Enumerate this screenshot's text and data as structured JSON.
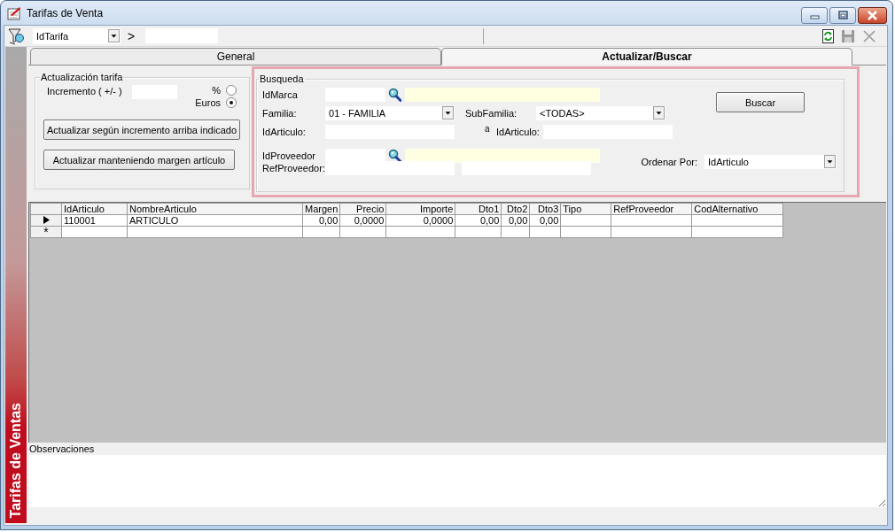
{
  "window": {
    "title": "Tarifas de Venta"
  },
  "toolbar": {
    "selector": {
      "value": "IdTarifa"
    },
    "separator": ">",
    "actions": [
      {
        "kind": "refresh",
        "disabled": false
      },
      {
        "kind": "save",
        "disabled": true
      },
      {
        "kind": "close",
        "disabled": true
      }
    ]
  },
  "side_banner": {
    "text": "Tarifas de Ventas"
  },
  "tabs": [
    {
      "label": "General",
      "selected": false
    },
    {
      "label": "Actualizar/Buscar",
      "selected": true
    }
  ],
  "update_group": {
    "title": "Actualización tarifa",
    "increment_label": "Incremento ( +/- )",
    "options": [
      {
        "label": "%",
        "selected": false
      },
      {
        "label": "Euros",
        "selected": true
      }
    ],
    "buttons": [
      "Actualizar según incremento arriba indicado",
      "Actualizar manteniendo margen artículo"
    ]
  },
  "search_group": {
    "title": "Busqueda",
    "marca_label": "IdMarca",
    "familia": {
      "label": "Familia:",
      "value": "01 - FAMILIA"
    },
    "subfamilia": {
      "label": "SubFamilia:",
      "value": "<TODAS>"
    },
    "articulo": {
      "from_label": "IdArticulo:",
      "connector": "a",
      "to_label": "IdArticulo:"
    },
    "proveedor_label": "IdProveedor",
    "ref_proveedor_label": "RefProveedor:",
    "order_by": {
      "label": "Ordenar Por:",
      "value": "IdArticulo"
    },
    "button": "Buscar"
  },
  "grid": {
    "columns": [
      {
        "label": "IdArticulo",
        "kind": "text"
      },
      {
        "label": "NombreArticulo",
        "kind": "text"
      },
      {
        "label": "Margen",
        "kind": "number"
      },
      {
        "label": "Precio",
        "kind": "number"
      },
      {
        "label": "Importe",
        "kind": "number"
      },
      {
        "label": "Dto1",
        "kind": "number"
      },
      {
        "label": "Dto2",
        "kind": "number"
      },
      {
        "label": "Dto3",
        "kind": "number"
      },
      {
        "label": "Tipo",
        "kind": "text"
      },
      {
        "label": "RefProveedor",
        "kind": "text"
      },
      {
        "label": "CodAlternativo",
        "kind": "text"
      }
    ],
    "rows": [
      {
        "current": true,
        "cells": [
          "110001",
          "ARTICULO",
          "0,00",
          "0,0000",
          "0,0000",
          "0,00",
          "0,00",
          "0,00"
        ]
      }
    ],
    "new_row_marker": "*"
  },
  "notes": {
    "label": "Observaciones"
  }
}
